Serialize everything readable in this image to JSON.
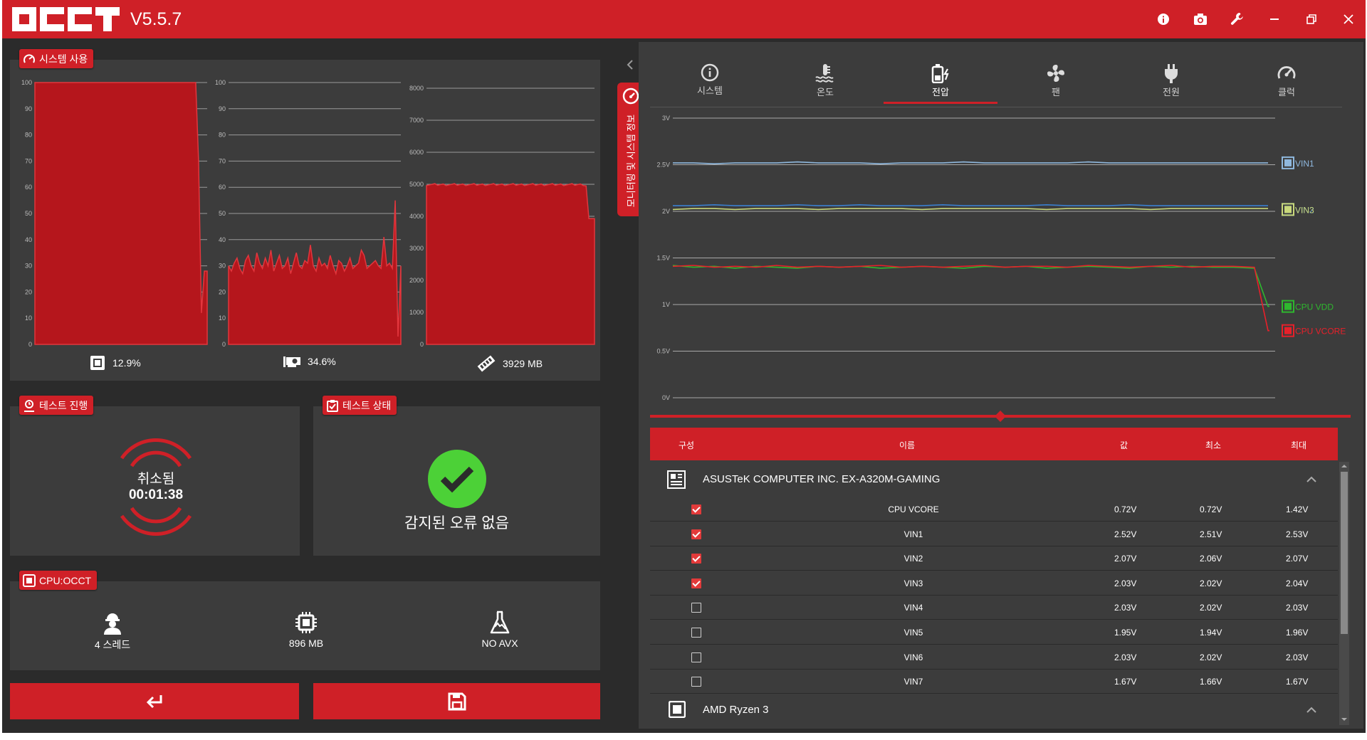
{
  "app": {
    "logo_text": "OCCT",
    "version": "V5.5.7"
  },
  "titlebar_icons": [
    "info-icon",
    "camera-icon",
    "wrench-icon",
    "minimize-icon",
    "restore-icon",
    "close-icon"
  ],
  "colors": {
    "accent": "#cf2027",
    "panel": "#3c3c3c",
    "bg": "#2b2b2b",
    "ok_green": "#4cd137",
    "vin1": "#8fb8de",
    "vin2": "#3a7fd0",
    "vin3": "#c9d87a",
    "cpu_vdd": "#2eb82e",
    "cpu_vcore": "#e8202a"
  },
  "system_usage": {
    "title": "시스템 사용",
    "charts": [
      {
        "name": "cpu",
        "yticks": [
          "100",
          "90",
          "80",
          "70",
          "60",
          "50",
          "40",
          "30",
          "20",
          "10",
          "0"
        ],
        "value_label": "12.9%",
        "icon": "cpu-icon"
      },
      {
        "name": "gpu",
        "yticks": [
          "100",
          "90",
          "80",
          "70",
          "60",
          "50",
          "40",
          "30",
          "20",
          "10",
          "0"
        ],
        "value_label": "34.6%",
        "icon": "gpu-icon"
      },
      {
        "name": "ram",
        "yticks": [
          "8000",
          "7000",
          "6000",
          "5000",
          "4000",
          "3000",
          "2000",
          "1000",
          "0"
        ],
        "value_label": "3929 MB",
        "icon": "memory-icon"
      }
    ]
  },
  "test_progress": {
    "title": "테스트 진행",
    "status": "취소됨",
    "time": "00:01:38"
  },
  "test_status": {
    "title": "테스트 상태",
    "message": "감지된 오류 없음"
  },
  "cpu_test": {
    "title": "CPU:OCCT",
    "items": [
      {
        "icon": "worker-icon",
        "label": "4 스레드"
      },
      {
        "icon": "chip-icon",
        "label": "896 MB"
      },
      {
        "icon": "flask-icon",
        "label": "NO AVX"
      }
    ]
  },
  "side_tab": {
    "label": "모니터링 및 시스템 정보"
  },
  "tabs": [
    {
      "icon": "info-circle-icon",
      "label": "시스템",
      "active": false
    },
    {
      "icon": "thermometer-icon",
      "label": "온도",
      "active": false
    },
    {
      "icon": "battery-bolt-icon",
      "label": "전압",
      "active": true
    },
    {
      "icon": "fan-icon",
      "label": "팬",
      "active": false
    },
    {
      "icon": "plug-icon",
      "label": "전원",
      "active": false
    },
    {
      "icon": "speedometer-icon",
      "label": "클럭",
      "active": false
    }
  ],
  "chart_data": {
    "type": "line",
    "yticks": [
      "3V",
      "2.5V",
      "2V",
      "1.5V",
      "1V",
      "0.5V",
      "0V"
    ],
    "ylim": [
      0,
      3
    ],
    "legend_placement": "right",
    "series": [
      {
        "name": "VIN1",
        "color": "#8fb8de",
        "values": [
          2.52,
          2.52,
          2.51,
          2.52,
          2.52,
          2.52,
          2.53,
          2.52,
          2.52,
          2.52,
          2.51,
          2.52,
          2.52,
          2.52,
          2.53,
          2.52,
          2.52,
          2.52,
          2.52,
          2.52,
          2.53,
          2.52,
          2.52,
          2.52,
          2.52,
          2.52,
          2.52,
          2.52,
          2.52,
          2.52
        ]
      },
      {
        "name": "VIN2",
        "color": "#3a7fd0",
        "values": [
          2.06,
          2.06,
          2.07,
          2.06,
          2.06,
          2.06,
          2.07,
          2.06,
          2.06,
          2.07,
          2.06,
          2.06,
          2.06,
          2.07,
          2.06,
          2.06,
          2.06,
          2.06,
          2.07,
          2.06,
          2.06,
          2.06,
          2.07,
          2.06,
          2.06,
          2.06,
          2.06,
          2.06,
          2.06,
          2.06
        ]
      },
      {
        "name": "VIN3",
        "color": "#c9d87a",
        "values": [
          2.02,
          2.03,
          2.03,
          2.02,
          2.03,
          2.03,
          2.03,
          2.02,
          2.03,
          2.03,
          2.03,
          2.03,
          2.02,
          2.03,
          2.03,
          2.03,
          2.03,
          2.03,
          2.02,
          2.03,
          2.03,
          2.03,
          2.03,
          2.02,
          2.03,
          2.03,
          2.03,
          2.03,
          2.03,
          2.03
        ]
      },
      {
        "name": "CPU VDD",
        "color": "#2eb82e",
        "values": [
          1.42,
          1.4,
          1.41,
          1.39,
          1.41,
          1.4,
          1.39,
          1.41,
          1.4,
          1.41,
          1.39,
          1.4,
          1.41,
          1.4,
          1.39,
          1.41,
          1.4,
          1.41,
          1.39,
          1.4,
          1.41,
          1.4,
          1.39,
          1.41,
          1.4,
          1.41,
          1.4,
          1.4,
          1.39,
          0.98
        ]
      },
      {
        "name": "CPU VCORE",
        "color": "#e8202a",
        "values": [
          1.41,
          1.42,
          1.4,
          1.41,
          1.4,
          1.42,
          1.4,
          1.41,
          1.4,
          1.41,
          1.42,
          1.4,
          1.41,
          1.4,
          1.41,
          1.42,
          1.4,
          1.41,
          1.41,
          1.4,
          1.42,
          1.41,
          1.4,
          1.41,
          1.42,
          1.4,
          1.41,
          1.41,
          1.4,
          0.72
        ]
      }
    ]
  },
  "table": {
    "headers": [
      "구성",
      "이름",
      "값",
      "최소",
      "최대"
    ],
    "group1": "ASUSTeK COMPUTER INC. EX-A320M-GAMING",
    "group2": "AMD Ryzen 3",
    "rows": [
      {
        "checked": true,
        "name": "CPU VCORE",
        "value": "0.72V",
        "min": "0.72V",
        "max": "1.42V"
      },
      {
        "checked": true,
        "name": "VIN1",
        "value": "2.52V",
        "min": "2.51V",
        "max": "2.53V"
      },
      {
        "checked": true,
        "name": "VIN2",
        "value": "2.07V",
        "min": "2.06V",
        "max": "2.07V"
      },
      {
        "checked": true,
        "name": "VIN3",
        "value": "2.03V",
        "min": "2.02V",
        "max": "2.04V"
      },
      {
        "checked": false,
        "name": "VIN4",
        "value": "2.03V",
        "min": "2.02V",
        "max": "2.03V"
      },
      {
        "checked": false,
        "name": "VIN5",
        "value": "1.95V",
        "min": "1.94V",
        "max": "1.96V"
      },
      {
        "checked": false,
        "name": "VIN6",
        "value": "2.03V",
        "min": "2.02V",
        "max": "2.03V"
      },
      {
        "checked": false,
        "name": "VIN7",
        "value": "1.67V",
        "min": "1.66V",
        "max": "1.67V"
      }
    ]
  }
}
